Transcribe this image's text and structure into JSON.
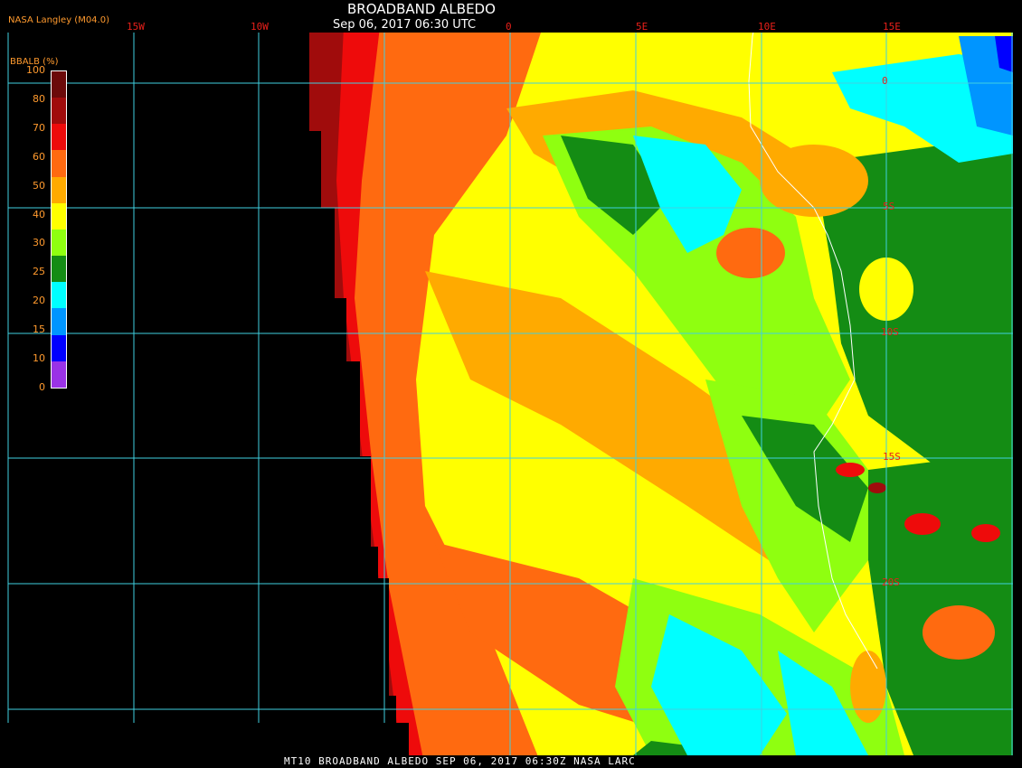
{
  "header": {
    "title": "BROADBAND ALBEDO",
    "datetime": "Sep 06, 2017 06:30 UTC",
    "source": "NASA Langley (M04.0)"
  },
  "footer": {
    "caption": "MT10  BROADBAND ALBEDO   SEP 06, 2017 06:30Z   NASA LARC"
  },
  "legend": {
    "title": "BBALB (%)",
    "ticks": [
      "100",
      "80",
      "70",
      "60",
      "50",
      "40",
      "30",
      "25",
      "20",
      "15",
      "10",
      "0"
    ],
    "colors": [
      "#6b0a0a",
      "#a00c0c",
      "#ee0b0b",
      "#ff6a10",
      "#ffaa00",
      "#ffff00",
      "#8fff10",
      "#148c14",
      "#00ffff",
      "#0095ff",
      "#0000ff",
      "#9a32e6"
    ]
  },
  "grid": {
    "color": "#3fd0e0",
    "longitude_labels": [
      "15W",
      "10W",
      "0",
      "5E",
      "10E",
      "15E"
    ],
    "latitude_labels": [
      "0",
      "5S",
      "10S",
      "15S",
      "20S"
    ]
  }
}
